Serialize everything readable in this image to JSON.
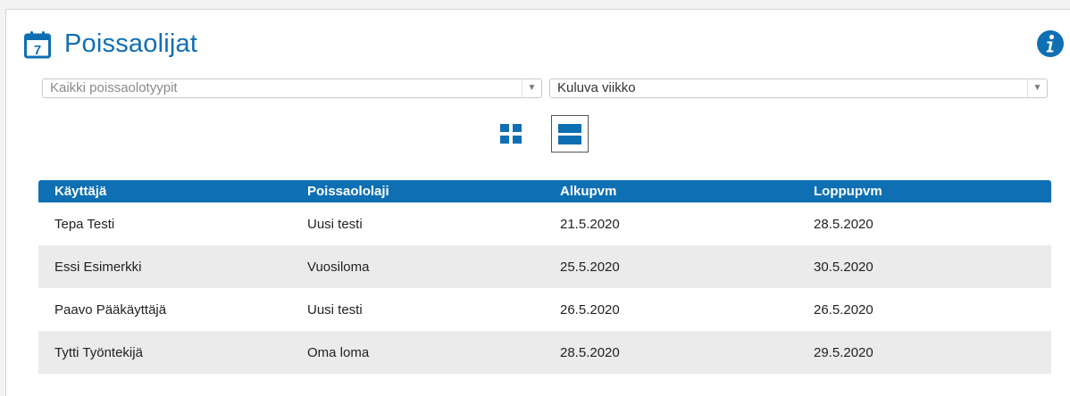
{
  "header": {
    "title": "Poissaolijat",
    "calendar_icon_number": "7"
  },
  "filters": {
    "absence_type": {
      "placeholder": "Kaikki poissaolotyypit",
      "caret": "▼"
    },
    "period": {
      "value": "Kuluva viikko",
      "caret": "▼"
    }
  },
  "view_toggle": {
    "options": [
      "grid-view",
      "list-view"
    ],
    "selected": "list-view"
  },
  "table": {
    "headers": [
      "Käyttäjä",
      "Poissaololaji",
      "Alkupvm",
      "Loppupvm"
    ],
    "rows": [
      [
        "Tepa Testi",
        "Uusi testi",
        "21.5.2020",
        "28.5.2020"
      ],
      [
        "Essi Esimerkki",
        "Vuosiloma",
        "25.5.2020",
        "30.5.2020"
      ],
      [
        "Paavo Pääkäyttäjä",
        "Uusi testi",
        "26.5.2020",
        "26.5.2020"
      ],
      [
        "Tytti Työntekijä",
        "Oma loma",
        "28.5.2020",
        "29.5.2020"
      ]
    ]
  },
  "colors": {
    "accent": "#0f6fb3",
    "row_alt": "#ebebeb",
    "header_text": "#ffffff"
  }
}
